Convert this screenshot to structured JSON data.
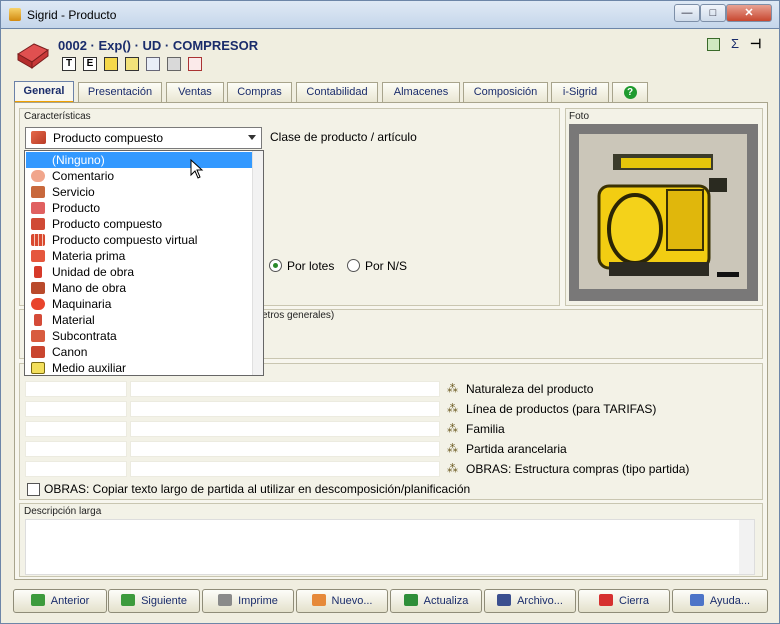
{
  "window": {
    "title": "Sigrid - Producto",
    "minimize": "—",
    "maximize": "□",
    "close": "✕"
  },
  "record": {
    "title": "0002 · Exp() · UD · COMPRESOR",
    "toolbar": [
      "T",
      "E",
      "",
      "",
      "",
      "",
      ""
    ]
  },
  "right_tools": {
    "sigma": "Σ",
    "pin": "⊣"
  },
  "tabs": [
    {
      "label": "General"
    },
    {
      "label": "Presentación"
    },
    {
      "label": "Ventas"
    },
    {
      "label": "Compras"
    },
    {
      "label": "Contabilidad"
    },
    {
      "label": "Almacenes"
    },
    {
      "label": "Composición"
    },
    {
      "label": "i-Sigrid"
    },
    {
      "label": "?"
    }
  ],
  "caracteristicas": {
    "label": "Características",
    "combo_value": "Producto compuesto",
    "combo_caption": "Clase de producto / artículo"
  },
  "dropdown": {
    "items": [
      "(Ninguno)",
      "Comentario",
      "Servicio",
      "Producto",
      "Producto compuesto",
      "Producto compuesto virtual",
      "Materia prima",
      "Unidad de obra",
      "Mano de obra",
      "Maquinaria",
      "Material",
      "Subcontrata",
      "Canon",
      "Medio auxiliar"
    ],
    "selected": "(Ninguno)"
  },
  "radios": {
    "lotes": "Por lotes",
    "ns": "Por N/S",
    "selected": "Por lotes"
  },
  "foto": {
    "label": "Foto"
  },
  "params_group": {
    "partial_label": "etros generales)"
  },
  "classification": [
    {
      "label": "Naturaleza del producto"
    },
    {
      "label": "Línea de productos (para TARIFAS)"
    },
    {
      "label": "Familia"
    },
    {
      "label": "Partida arancelaria"
    },
    {
      "label": "OBRAS: Estructura compras (tipo partida)"
    }
  ],
  "obras_checkbox": {
    "label": "OBRAS: Copiar texto largo de partida al utilizar en descomposición/planificación",
    "checked": false
  },
  "descripcion": {
    "label": "Descripción larga"
  },
  "buttons": {
    "anterior": "Anterior",
    "siguiente": "Siguiente",
    "imprime": "Imprime",
    "nuevo": "Nuevo...",
    "actualiza": "Actualiza",
    "archivo": "Archivo...",
    "cierra": "Cierra",
    "ayuda": "Ayuda..."
  },
  "colors": {
    "selection": "#3399ff",
    "active_tab_underline": "#f0a000",
    "header_text": "#1a2c6b"
  }
}
